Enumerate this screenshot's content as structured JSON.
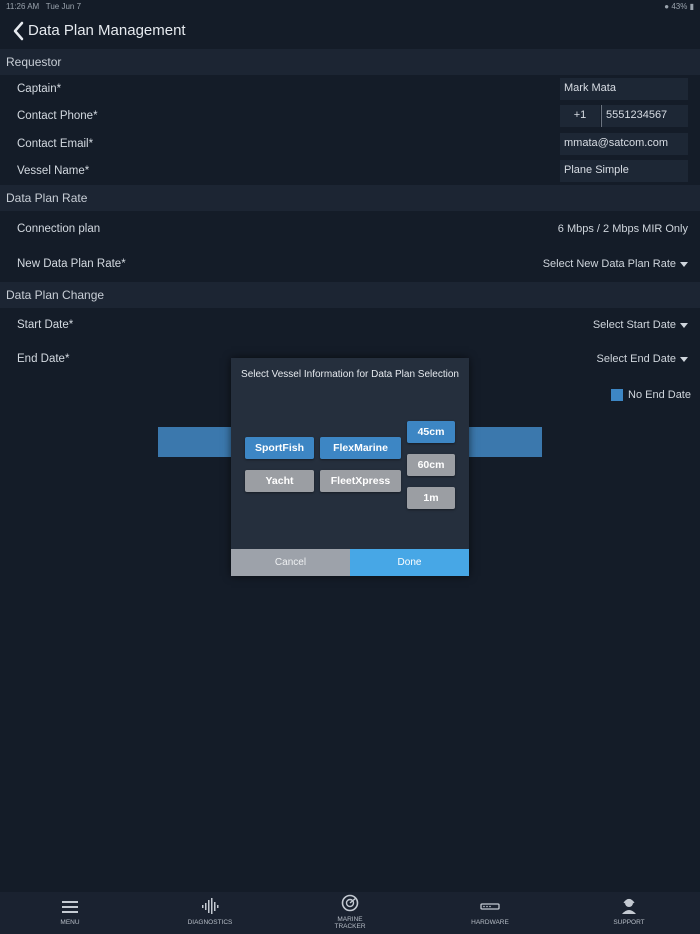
{
  "status_bar": {
    "time": "11:26 AM",
    "date": "Tue Jun 7",
    "battery": "43%"
  },
  "nav": {
    "title": "Data Plan Management"
  },
  "sections": {
    "requestor": "Requestor",
    "rate": "Data Plan Rate",
    "change": "Data Plan Change"
  },
  "requestor": {
    "captain_label": "Captain*",
    "captain_value": "Mark Mata",
    "phone_label": "Contact Phone*",
    "phone_code": "+1",
    "phone_value": "5551234567",
    "email_label": "Contact Email*",
    "email_value": "mmata@satcom.com",
    "vessel_label": "Vessel Name*",
    "vessel_value": "Plane Simple"
  },
  "rate": {
    "connection_label": "Connection plan",
    "connection_value": "6 Mbps / 2 Mbps MIR Only",
    "new_rate_label": "New Data Plan Rate*",
    "new_rate_value": "Select New Data Plan Rate"
  },
  "change": {
    "start_label": "Start Date*",
    "start_value": "Select Start Date",
    "end_label": "End Date*",
    "end_value": "Select End Date",
    "no_end_label": "No End Date"
  },
  "modal": {
    "title": "Select Vessel Information for Data Plan Selection",
    "vessels": [
      {
        "label": "SportFish",
        "selected": true
      },
      {
        "label": "FlexMarine",
        "selected": true
      },
      {
        "label": "Yacht",
        "selected": false
      },
      {
        "label": "FleetXpress",
        "selected": false
      }
    ],
    "sizes": [
      {
        "label": "45cm",
        "selected": true
      },
      {
        "label": "60cm",
        "selected": false
      },
      {
        "label": "1m",
        "selected": false
      }
    ],
    "cancel": "Cancel",
    "done": "Done"
  },
  "tabs": [
    {
      "label": "MENU",
      "icon": "menu-icon"
    },
    {
      "label": "DIAGNOSTICS",
      "icon": "waveform-icon"
    },
    {
      "label": "MARINE\nTRACKER",
      "icon": "radar-icon"
    },
    {
      "label": "HARDWARE",
      "icon": "router-icon"
    },
    {
      "label": "SUPPORT",
      "icon": "support-agent-icon"
    }
  ],
  "colors": {
    "background": "#141c28",
    "section": "#1c2533",
    "accent": "#3d86c4",
    "done": "#47a7e6",
    "inactive": "#9b9ea3"
  }
}
